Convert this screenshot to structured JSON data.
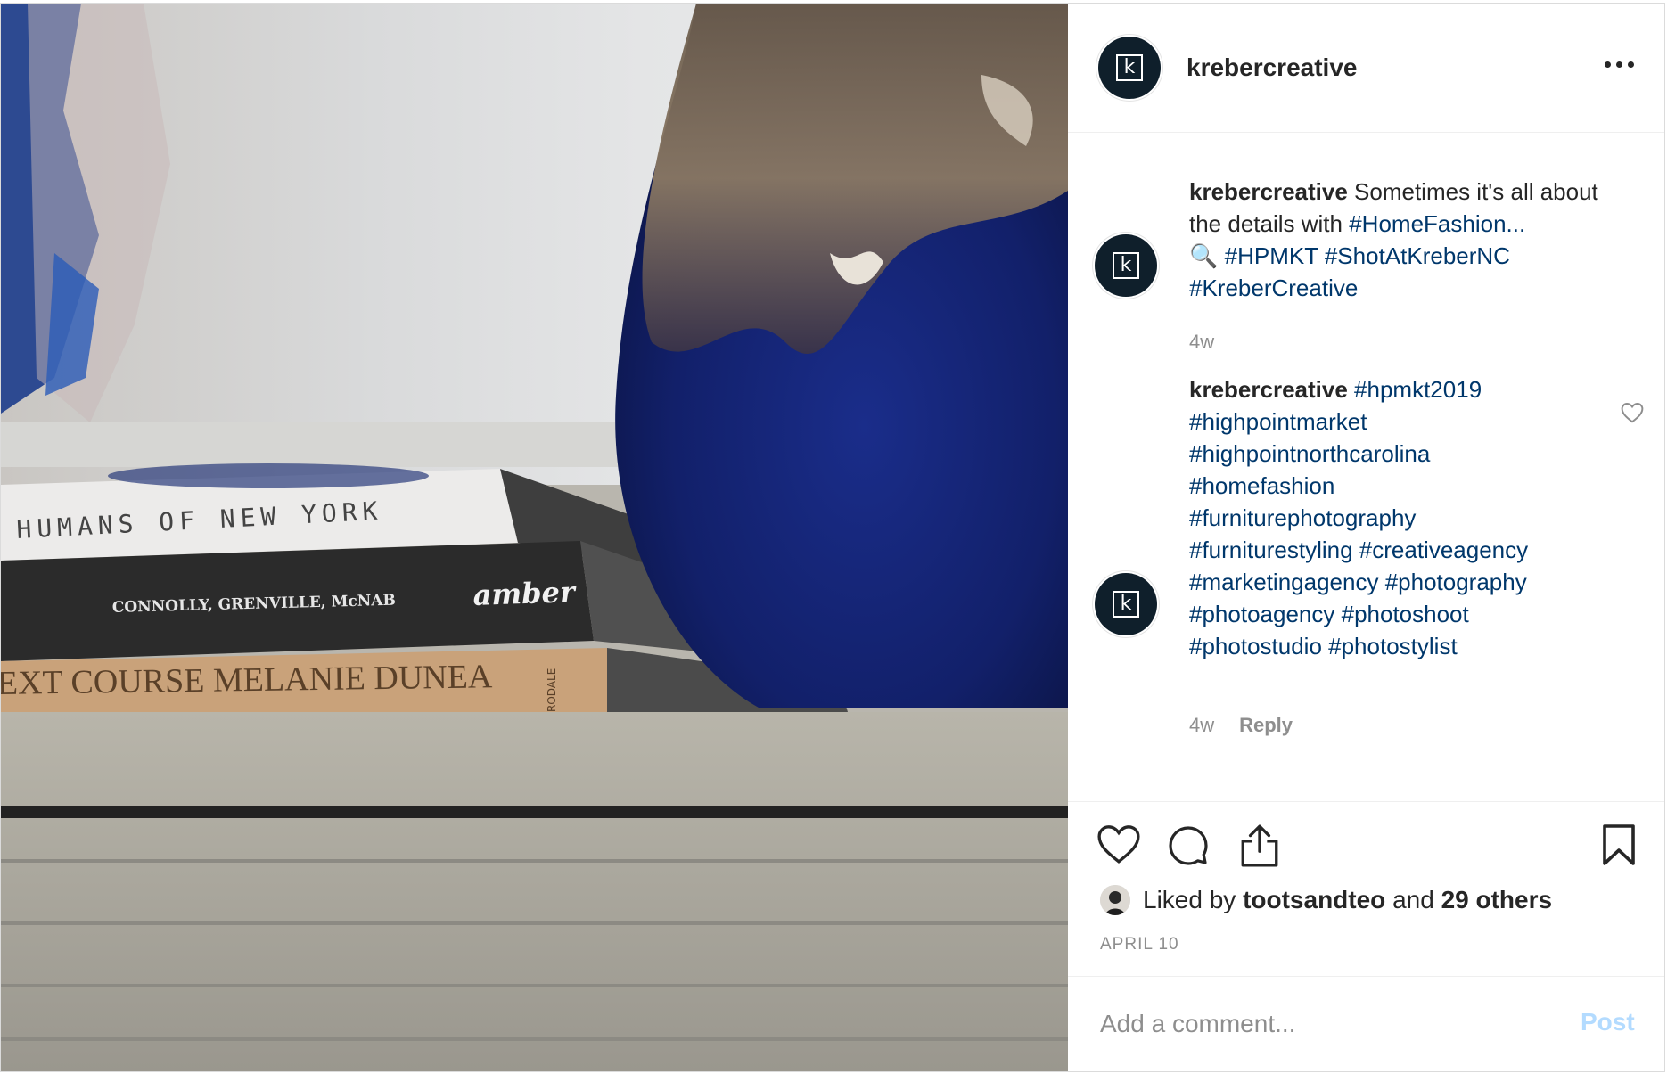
{
  "post": {
    "author": "krebercreative",
    "avatar_letter": "k",
    "more_icon": "more-icon"
  },
  "comments": [
    {
      "author": "krebercreative",
      "text_before": " Sometimes it's all about the details with ",
      "tag1": "#HomeFashion...",
      "emoji": "🔍",
      "tags_rest": [
        "#HPMKT",
        "#ShotAtKreberNC",
        "#KreberCreative"
      ],
      "time": "4w"
    },
    {
      "author": "krebercreative",
      "tags": [
        "#hpmkt2019",
        "#highpointmarket",
        "#highpointnorthcarolina",
        "#homefashion",
        "#furniturephotography",
        "#furniturestyling",
        "#creativeagency",
        "#marketingagency",
        "#photography",
        "#photoagency",
        "#photoshoot",
        "#photostudio",
        "#photostylist"
      ],
      "time": "4w",
      "reply_label": "Reply"
    }
  ],
  "photo": {
    "book1": "HUMANS OF NEW YORK",
    "book2_authors": "CONNOLLY, GRENVILLE, McNAB",
    "book2_title": "amber",
    "book3": "EXT COURSE  MELANIE DUNEA",
    "book3_publisher": "RODALE"
  },
  "likes": {
    "prefix": "Liked by ",
    "user": "tootsandteo",
    "middle": " and ",
    "others": "29 others"
  },
  "date": "APRIL 10",
  "comment_input": {
    "placeholder": "Add a comment..."
  },
  "post_button": "Post",
  "colors": {
    "link": "#00376b",
    "muted": "#8e8e8e",
    "post_disabled": "#b3dbff",
    "avatar_bg": "#0f1f2b"
  }
}
